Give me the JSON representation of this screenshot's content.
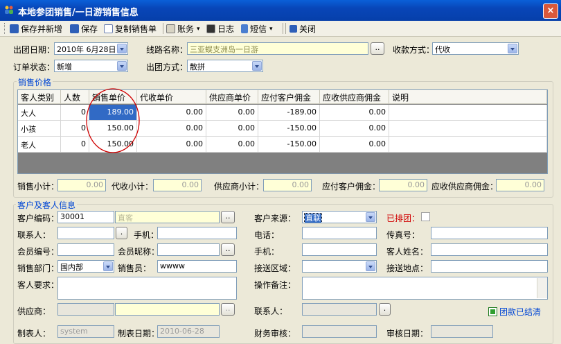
{
  "window": {
    "title": "本地参团销售/一日游销售信息",
    "close": "×"
  },
  "toolbar": {
    "save_new": "保存并新增",
    "save": "保存",
    "copy_sale": "复制销售单",
    "account": "账务",
    "log": "日志",
    "sms": "短信",
    "close": "关闭"
  },
  "header": {
    "depart_date_label": "出团日期：",
    "depart_date_value": "2010年 6月28日",
    "route_label": "线路名称：",
    "route_value": "三亚蜈支洲岛一日游",
    "payment_label": "收款方式：",
    "payment_value": "代收",
    "order_status_label": "订单状态：",
    "order_status_value": "新增",
    "group_mode_label": "出团方式：",
    "group_mode_value": "散拼"
  },
  "price_section": {
    "title": "销售价格",
    "columns": [
      "客人类别",
      "人数",
      "销售单价",
      "代收单价",
      "供应商单价",
      "应付客户佣金",
      "应收供应商佣金",
      "说明"
    ],
    "rows": [
      {
        "category": "大人",
        "count": "0",
        "sale_price": "189.00",
        "collect_price": "0.00",
        "supplier_price": "0.00",
        "pay_commission": "-189.00",
        "recv_commission": "0.00",
        "note": ""
      },
      {
        "category": "小孩",
        "count": "0",
        "sale_price": "150.00",
        "collect_price": "0.00",
        "supplier_price": "0.00",
        "pay_commission": "-150.00",
        "recv_commission": "0.00",
        "note": ""
      },
      {
        "category": "老人",
        "count": "0",
        "sale_price": "150.00",
        "collect_price": "0.00",
        "supplier_price": "0.00",
        "pay_commission": "-150.00",
        "recv_commission": "0.00",
        "note": ""
      }
    ],
    "subtotals": {
      "sale_label": "销售小计：",
      "sale_value": "0.00",
      "collect_label": "代收小计：",
      "collect_value": "0.00",
      "supplier_label": "供应商小计：",
      "supplier_value": "0.00",
      "pay_comm_label": "应付客户佣金：",
      "pay_comm_value": "0.00",
      "recv_comm_label": "应收供应商佣金：",
      "recv_comm_value": "0.00"
    }
  },
  "customer": {
    "title": "客户及客人信息",
    "code_label": "客户编码：",
    "code_value": "30001",
    "name_value": "直客",
    "source_label": "客户来源：",
    "source_value": "直联",
    "grouped_label": "已排团：",
    "contact_label": "联系人：",
    "mobile_label": "手机：",
    "phone_label": "电话：",
    "fax_label": "传真号：",
    "member_no_label": "会员编号：",
    "member_nick_label": "会员昵称：",
    "mobile2_label": "手机：",
    "guest_name_label": "客人姓名：",
    "dept_label": "销售部门：",
    "dept_value": "国内部",
    "salesman_label": "销售员：",
    "salesman_value": "wwww",
    "pickup_area_label": "接送区域：",
    "pickup_place_label": "接送地点：",
    "guest_req_label": "客人要求：",
    "op_note_label": "操作备注：",
    "supplier_label": "供应商：",
    "supplier_contact_label": "联系人：",
    "settled_label": "团款已结清",
    "creator_label": "制表人：",
    "creator_value": "system",
    "create_date_label": "制表日期：",
    "create_date_value": "2010-06-28",
    "finance_label": "财务审核：",
    "audit_date_label": "审核日期："
  },
  "colors": {
    "titlebar": "#0A5FD8",
    "accent_red": "#D00000",
    "selected": "#316AC5",
    "group_title": "#0046D5"
  }
}
